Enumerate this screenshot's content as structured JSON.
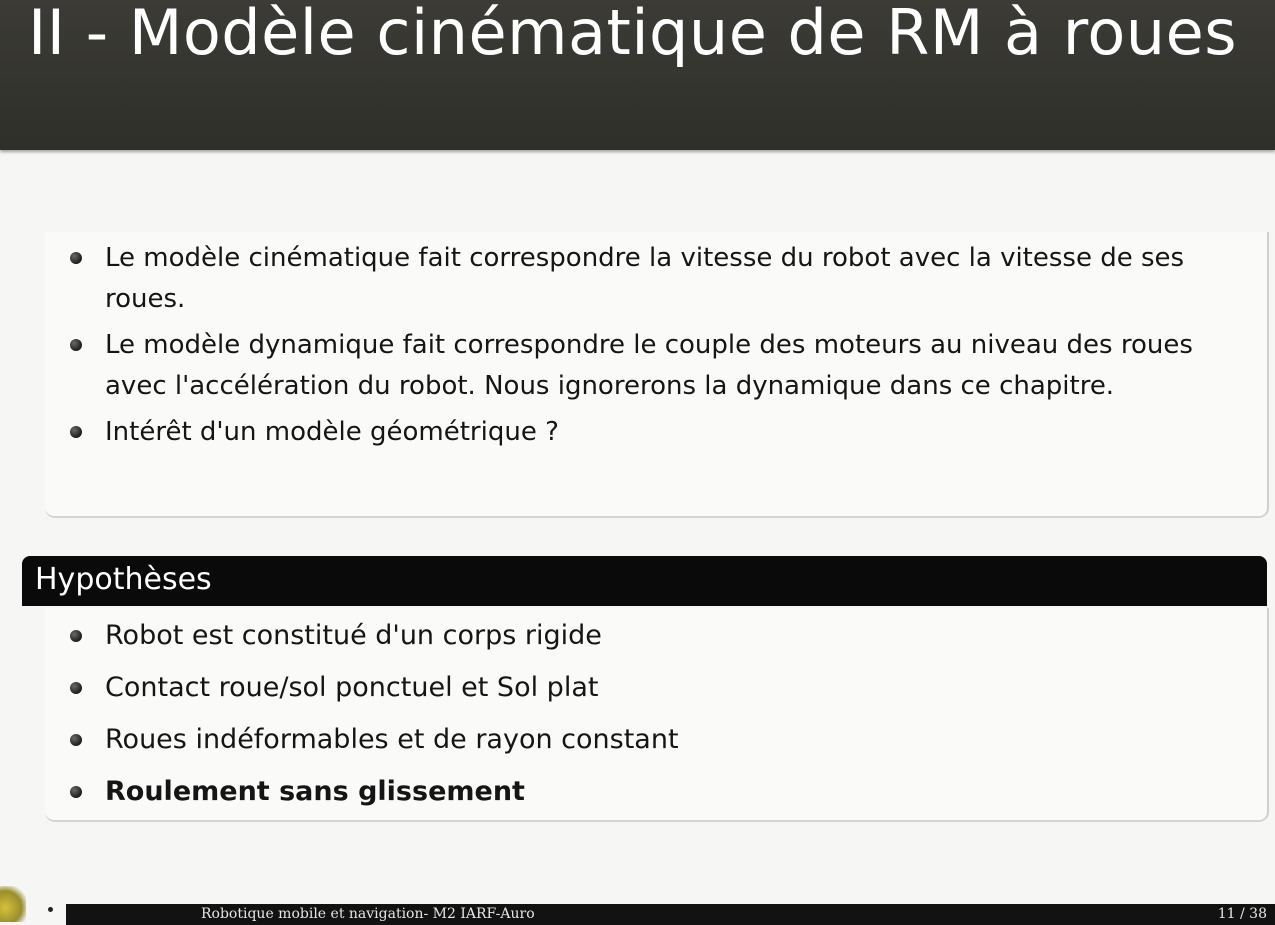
{
  "slide": {
    "title": "II - Modèle cinématique de RM à roues"
  },
  "intro_block": {
    "items": [
      "Le modèle cinématique fait correspondre la vitesse du robot avec la vitesse de ses roues.",
      "Le modèle dynamique fait correspondre le couple des moteurs au niveau des roues avec l'accélération du robot. Nous ignorerons la dynamique dans ce chapitre.",
      "Intérêt d'un modèle géométrique ?"
    ]
  },
  "hypotheses_block": {
    "title": "Hypothèses",
    "items": [
      "Robot est constitué d'un corps rigide",
      "Contact roue/sol ponctuel et Sol plat",
      "Roues indéformables et de rayon constant",
      "Roulement sans glissement"
    ]
  },
  "footer": {
    "text": "Robotique mobile et navigation- M2 IARF-Auro",
    "page": "11 / 38"
  },
  "colors": {
    "title_bar": "#35352f",
    "header_bar": "#0a0a0a",
    "background": "#f6f6f4",
    "text": "#151515"
  }
}
